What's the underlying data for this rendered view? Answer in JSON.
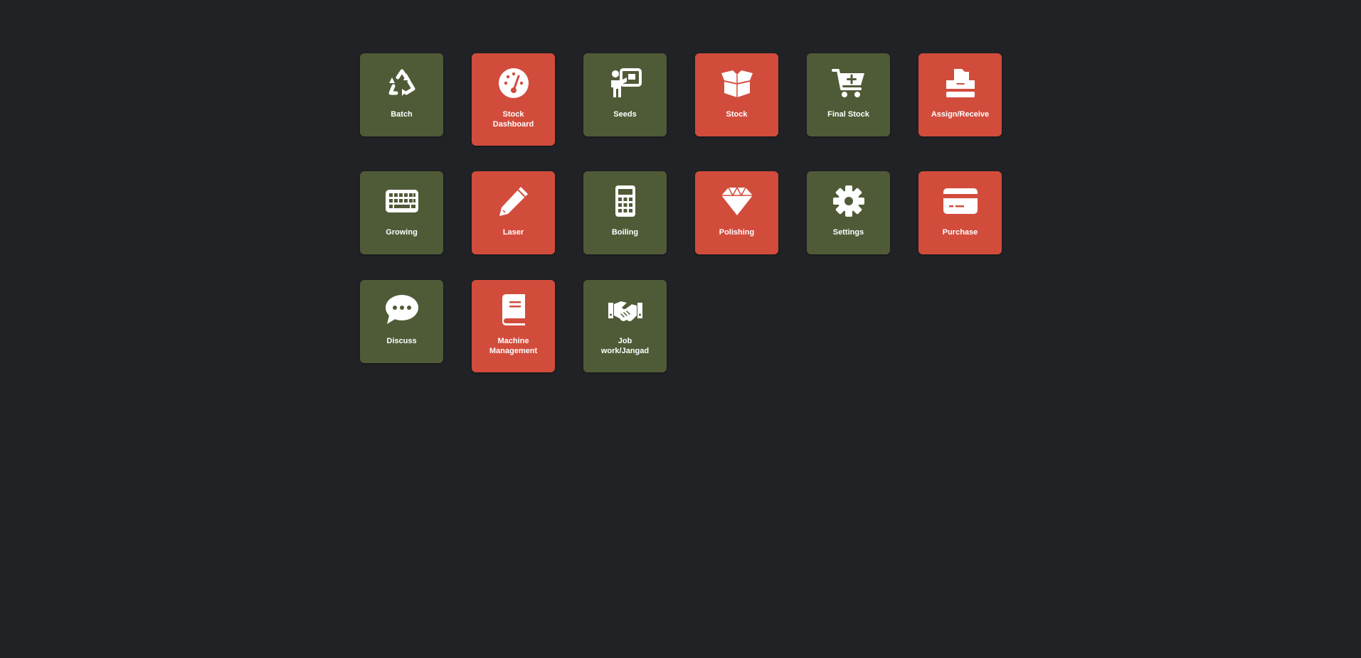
{
  "colors": {
    "background": "#202226",
    "tile_green": "#4f5b37",
    "tile_red": "#d24c3c",
    "icon": "#ffffff"
  },
  "tiles": [
    {
      "label": "Batch",
      "icon": "recycle-icon",
      "color": "green"
    },
    {
      "label": "Stock\nDashboard",
      "icon": "gauge-icon",
      "color": "red"
    },
    {
      "label": "Seeds",
      "icon": "presentation-icon",
      "color": "green"
    },
    {
      "label": "Stock",
      "icon": "open-box-icon",
      "color": "red"
    },
    {
      "label": "Final Stock",
      "icon": "cart-plus-icon",
      "color": "green"
    },
    {
      "label": "Assign/Receive",
      "icon": "inbox-tray-icon",
      "color": "red"
    },
    {
      "label": "Growing",
      "icon": "keyboard-icon",
      "color": "green"
    },
    {
      "label": "Laser",
      "icon": "pencil-icon",
      "color": "red"
    },
    {
      "label": "Boiling",
      "icon": "calculator-icon",
      "color": "green"
    },
    {
      "label": "Polishing",
      "icon": "gem-icon",
      "color": "red"
    },
    {
      "label": "Settings",
      "icon": "gear-icon",
      "color": "green"
    },
    {
      "label": "Purchase",
      "icon": "credit-card-icon",
      "color": "red"
    },
    {
      "label": "Discuss",
      "icon": "chat-bubble-icon",
      "color": "green"
    },
    {
      "label": "Machine\nManagement",
      "icon": "book-icon",
      "color": "red"
    },
    {
      "label": "Job\nwork/Jangad",
      "icon": "handshake-icon",
      "color": "green"
    }
  ]
}
